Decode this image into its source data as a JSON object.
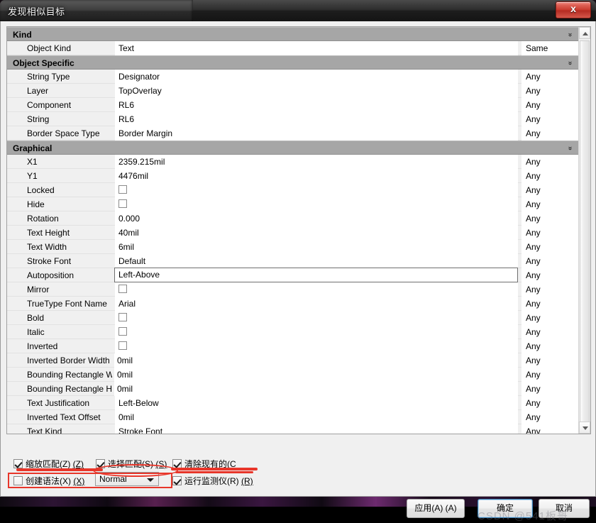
{
  "window": {
    "title": "发现相似目标",
    "close_label": "x"
  },
  "grid": {
    "groups": [
      {
        "name": "Kind",
        "collapse_icon": "chevron-double-down-icon",
        "rows": [
          {
            "label": "Object Kind",
            "value": "Text",
            "type": "text",
            "match": "Same"
          }
        ]
      },
      {
        "name": "Object Specific",
        "collapse_icon": "chevron-double-down-icon",
        "rows": [
          {
            "label": "String Type",
            "value": "Designator",
            "type": "text",
            "match": "Any"
          },
          {
            "label": "Layer",
            "value": "TopOverlay",
            "type": "text",
            "match": "Any"
          },
          {
            "label": "Component",
            "value": "RL6",
            "type": "text",
            "match": "Any"
          },
          {
            "label": "String",
            "value": "RL6",
            "type": "text",
            "match": "Any"
          },
          {
            "label": "Border Space Type",
            "value": "Border Margin",
            "type": "text",
            "match": "Any"
          }
        ]
      },
      {
        "name": "Graphical",
        "collapse_icon": "chevron-double-down-icon",
        "rows": [
          {
            "label": "X1",
            "value": "2359.215mil",
            "type": "text",
            "match": "Any"
          },
          {
            "label": "Y1",
            "value": "4476mil",
            "type": "text",
            "match": "Any"
          },
          {
            "label": "Locked",
            "value": "",
            "type": "checkbox",
            "checked": false,
            "match": "Any"
          },
          {
            "label": "Hide",
            "value": "",
            "type": "checkbox",
            "checked": false,
            "match": "Any"
          },
          {
            "label": "Rotation",
            "value": "0.000",
            "type": "text",
            "match": "Any"
          },
          {
            "label": "Text Height",
            "value": "40mil",
            "type": "text",
            "match": "Any"
          },
          {
            "label": "Text Width",
            "value": "6mil",
            "type": "text",
            "match": "Any"
          },
          {
            "label": "Stroke Font",
            "value": "Default",
            "type": "text",
            "match": "Any"
          },
          {
            "label": "Autoposition",
            "value": "Left-Above",
            "type": "text",
            "match": "Any",
            "focused": true
          },
          {
            "label": "Mirror",
            "value": "",
            "type": "checkbox",
            "checked": false,
            "match": "Any"
          },
          {
            "label": "TrueType Font Name",
            "value": "Arial",
            "type": "text",
            "match": "Any"
          },
          {
            "label": "Bold",
            "value": "",
            "type": "checkbox",
            "checked": false,
            "match": "Any"
          },
          {
            "label": "Italic",
            "value": "",
            "type": "checkbox",
            "checked": false,
            "match": "Any"
          },
          {
            "label": "Inverted",
            "value": "",
            "type": "checkbox",
            "checked": false,
            "match": "Any"
          },
          {
            "label": "Inverted Border Width",
            "value": "0mil",
            "type": "text-wide",
            "match": "Any"
          },
          {
            "label": "Bounding Rectangle W",
            "value": "0mil",
            "type": "text-wide",
            "match": "Any"
          },
          {
            "label": "Bounding Rectangle H",
            "value": "0mil",
            "type": "text-wide",
            "match": "Any"
          },
          {
            "label": "Text Justification",
            "value": "Left-Below",
            "type": "text",
            "match": "Any"
          },
          {
            "label": "Inverted Text Offset",
            "value": "0mil",
            "type": "text",
            "match": "Any"
          },
          {
            "label": "Text Kind",
            "value": "Stroke Font",
            "type": "text",
            "match": "Any"
          }
        ]
      }
    ],
    "scrollbar": {
      "up_icon": "triangle-up-icon",
      "down_icon": "triangle-down-icon"
    }
  },
  "options": {
    "zoom_match": {
      "label": "缩放匹配(Z)",
      "accel": "(Z)",
      "checked": true
    },
    "select_match": {
      "label": "选择匹配(S)",
      "accel": "(S)",
      "checked": true
    },
    "clear_existing": {
      "label": "清除现有的(C",
      "accel": "",
      "checked": true
    },
    "create_expression": {
      "label": "创建语法(X)",
      "accel": "(X)",
      "checked": false
    },
    "run_inspector": {
      "label": "运行监测仪(R)",
      "accel": "(R)",
      "checked": true
    },
    "scope_select": {
      "value": "Normal",
      "arrow_icon": "chevron-down-icon"
    }
  },
  "footer": {
    "apply": "应用(A) (A)",
    "ok": "确定",
    "cancel": "取消"
  },
  "watermark": "CSDN @541板哥",
  "colors": {
    "group_header": "#a6a6a6",
    "annotation_red": "#e8362a",
    "close_red": "#c8382c",
    "default_button_border": "#3c7fb1"
  }
}
